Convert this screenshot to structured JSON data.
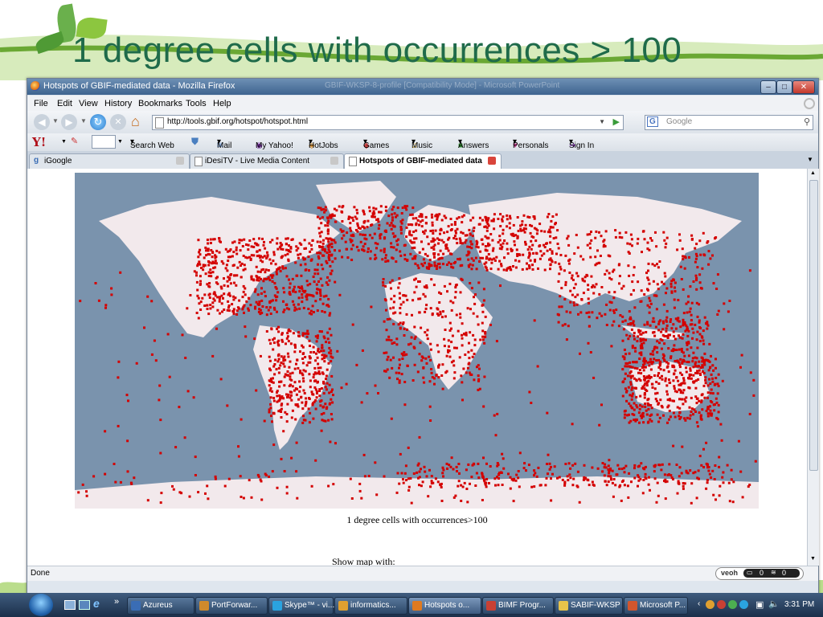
{
  "slide": {
    "title": "1 degree cells with occurrences > 100"
  },
  "window": {
    "title": "Hotspots of GBIF-mediated data - Mozilla Firefox",
    "background_title": "GBIF-WKSP-8-profile [Compatibility Mode] - Microsoft PowerPoint"
  },
  "menu": [
    "File",
    "Edit",
    "View",
    "History",
    "Bookmarks",
    "Tools",
    "Help"
  ],
  "nav": {
    "url": "http://tools.gbif.org/hotspot/hotspot.html",
    "search_placeholder": "Google",
    "search_engine_label": "G"
  },
  "yahoo_toolbar": {
    "logo": "Y!",
    "items": [
      "Search Web",
      "Mail",
      "My Yahoo!",
      "HotJobs",
      "Games",
      "Music",
      "Answers",
      "Personals",
      "Sign In"
    ]
  },
  "tabs": [
    {
      "label": "iGoogle",
      "active": false
    },
    {
      "label": "iDesiTV - Live Media Content",
      "active": false
    },
    {
      "label": "Hotspots of GBIF-mediated data",
      "active": true
    }
  ],
  "page": {
    "caption": "1 degree cells with occurrences>100",
    "show_map_label": "Show map with:"
  },
  "status": {
    "text": "Done",
    "veoh_label": "veoh",
    "veoh_counts": [
      "0",
      "0"
    ]
  },
  "taskbar": {
    "items": [
      {
        "label": "Azureus",
        "color": "#3a6db5"
      },
      {
        "label": "PortForwar...",
        "color": "#d08a2c"
      },
      {
        "label": "Skype™ - vi...",
        "color": "#2aa3e0"
      },
      {
        "label": "informatics...",
        "color": "#e0a030"
      },
      {
        "label": "Hotspots o...",
        "color": "#e07a20",
        "active": true
      },
      {
        "label": "BIMF Progr...",
        "color": "#c94034"
      },
      {
        "label": "SABIF-WKSP",
        "color": "#e8c34a"
      },
      {
        "label": "Microsoft P...",
        "color": "#d2562e"
      }
    ],
    "clock": "3:31 PM"
  },
  "colors": {
    "ocean": "#7a93ad",
    "land": "#f2e9ec",
    "hotspot": "#d40000",
    "slide_title": "#1f6b4a"
  }
}
